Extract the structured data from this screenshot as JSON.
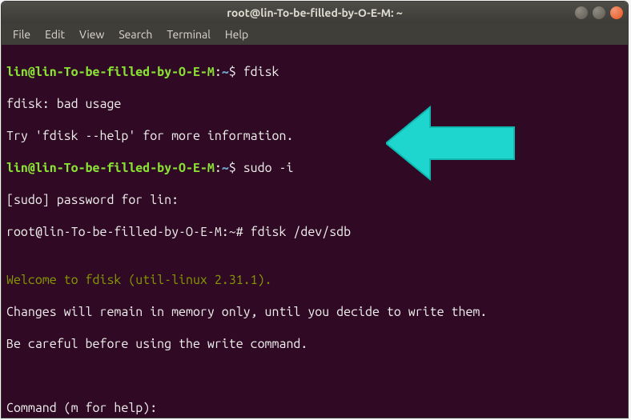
{
  "titlebar": {
    "title": "root@lin-To-be-filled-by-O-E-M: ~"
  },
  "menu": {
    "file": "File",
    "edit": "Edit",
    "view": "View",
    "search": "Search",
    "terminal": "Terminal",
    "help": "Help"
  },
  "terminal": {
    "line1_prompt_user": "lin@lin-To-be-filled-by-O-E-M",
    "line1_colon": ":",
    "line1_path": "~",
    "line1_dollar": "$ ",
    "line1_cmd": "fdisk",
    "line2": "fdisk: bad usage",
    "line3": "Try 'fdisk --help' for more information.",
    "line4_prompt_user": "lin@lin-To-be-filled-by-O-E-M",
    "line4_colon": ":",
    "line4_path": "~",
    "line4_dollar": "$ ",
    "line4_cmd": "sudo -i",
    "line5": "[sudo] password for lin:",
    "line6_prompt": "root@lin-To-be-filled-by-O-E-M:~# ",
    "line6_cmd": "fdisk /dev/sdb",
    "blank": "",
    "line8": "Welcome to fdisk (util-linux 2.31.1).",
    "line9": "Changes will remain in memory only, until you decide to write them.",
    "line10": "Be careful before using the write command.",
    "line12": "Command (m for help): "
  },
  "annotation": {
    "arrow_color": "#1fd6cf"
  }
}
